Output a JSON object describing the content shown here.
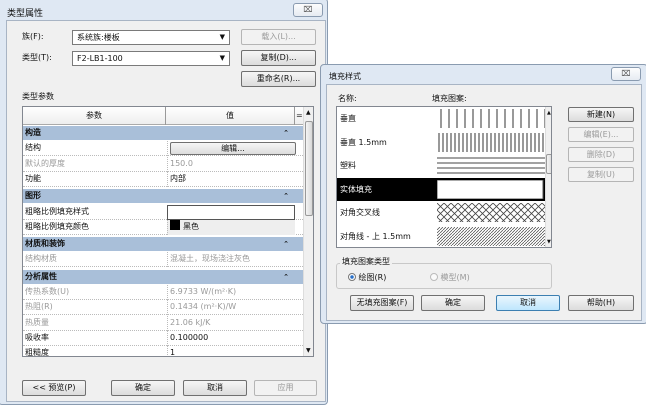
{
  "type_props": {
    "title": "类型属性",
    "close": "⌧",
    "family_label": "族(F):",
    "family_value": "系统族:楼板",
    "load_btn": "载入(L)...",
    "type_label": "类型(T):",
    "type_value": "F2-LB1-100",
    "duplicate_btn": "复制(D)...",
    "rename_btn": "重命名(R)...",
    "params_label": "类型参数",
    "col_param": "参数",
    "col_value": "值",
    "col_eq": "=",
    "rows": [
      {
        "kind": "group",
        "param": "构造"
      },
      {
        "kind": "button",
        "param": "结构",
        "value": "编辑..."
      },
      {
        "kind": "ro",
        "param": "默认的厚度",
        "value": "150.0"
      },
      {
        "kind": "norm",
        "param": "功能",
        "value": "内部"
      },
      {
        "kind": "group",
        "param": "图形"
      },
      {
        "kind": "input",
        "param": "粗略比例填充样式",
        "value": ""
      },
      {
        "kind": "color",
        "param": "粗略比例填充颜色",
        "value": "黑色"
      },
      {
        "kind": "group",
        "param": "材质和装饰"
      },
      {
        "kind": "ro",
        "param": "结构材质",
        "value": "混凝土，现场浇注灰色"
      },
      {
        "kind": "group",
        "param": "分析属性"
      },
      {
        "kind": "ro",
        "param": "传热系数(U)",
        "value": "6.9733 W/(m²·K)"
      },
      {
        "kind": "ro",
        "param": "热阻(R)",
        "value": "0.1434 (m²·K)/W"
      },
      {
        "kind": "ro",
        "param": "热质量",
        "value": "21.06 kJ/K"
      },
      {
        "kind": "norm",
        "param": "吸收率",
        "value": "0.100000"
      },
      {
        "kind": "norm",
        "param": "粗糙度",
        "value": "1"
      }
    ],
    "preview_btn": "<< 预览(P)",
    "ok_btn": "确定",
    "cancel_btn": "取消",
    "apply_btn": "应用"
  },
  "fill_styles": {
    "title": "填充样式",
    "close": "⌧",
    "col_name": "名称:",
    "col_pattern": "填充图案:",
    "items": [
      {
        "name": "垂直",
        "pattern": "vertical"
      },
      {
        "name": "垂直 1.5mm",
        "pattern": "vertical-dense"
      },
      {
        "name": "塑料",
        "pattern": "horizontal"
      },
      {
        "name": "实体填充",
        "pattern": "solid",
        "selected": true
      },
      {
        "name": "对角交叉线",
        "pattern": "crosshatch"
      },
      {
        "name": "对角线 - 上 1.5mm",
        "pattern": "diagonal"
      }
    ],
    "new_btn": "新建(N)",
    "edit_btn": "编辑(E)...",
    "delete_btn": "删除(D)",
    "copy_btn": "复制(U)",
    "type_group": "填充图案类型",
    "radio_drafting": "绘图(R)",
    "radio_model": "模型(M)",
    "nofill_btn": "无填充图案(F)",
    "ok_btn": "确定",
    "cancel_btn": "取消",
    "help_btn": "帮助(H)"
  }
}
